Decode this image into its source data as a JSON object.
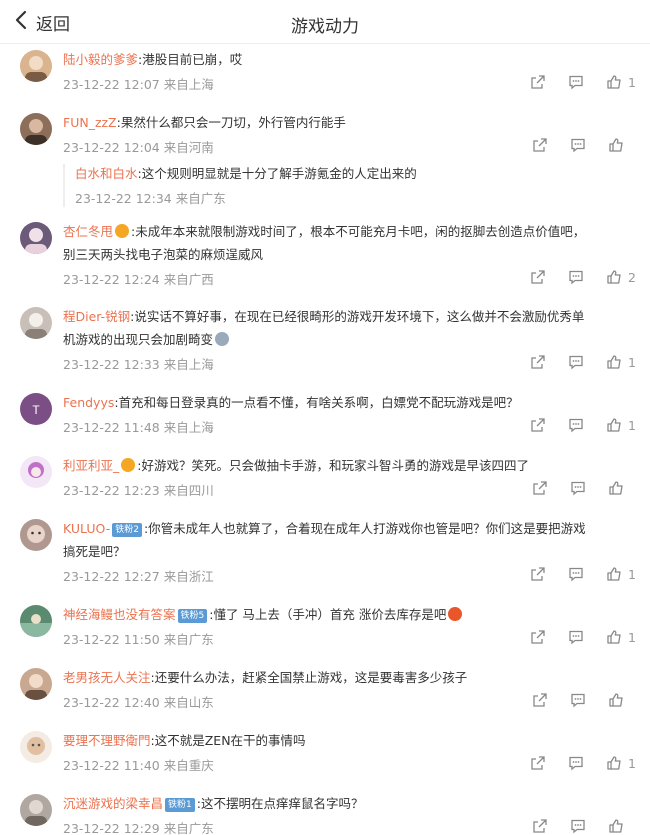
{
  "header": {
    "back_label": "返回",
    "title": "游戏动力"
  },
  "comments": [
    {
      "user": "陆小毅的爹爹",
      "badge": "",
      "text": ":港股目前已崩，哎",
      "text2": "",
      "time": "23-12-22 12:07 来自上海",
      "likes": "1",
      "avatar_color": "#d9b48f"
    },
    {
      "user": "FUN_zzZ",
      "badge": "",
      "text": ":果然什么都只会一刀切，外行管内行能手",
      "text2": "",
      "time": "23-12-22 12:04 来自河南",
      "likes": "",
      "avatar_color": "#8c6e5a",
      "reply": {
        "user": "白水和白水",
        "text": ":这个规则明显就是十分了解手游氪金的人定出来的",
        "time": "23-12-22 12:34 来自广东"
      }
    },
    {
      "user": "杏仁冬甩",
      "badge": "",
      "text": ":未成年本来就限制游戏时间了，根本不可能充月卡吧，闲的抠脚去创造点价值吧，",
      "text2": "别三天两头找电子泡菜的麻烦逞威风",
      "time": "23-12-22 12:24 来自广西",
      "likes": "2",
      "avatar_color": "#6b5a7a"
    },
    {
      "user": "程Dier-锐钢",
      "badge": "",
      "text": ":说实话不算好事，在现在已经很畸形的游戏开发环境下，这么做并不会激励优秀单",
      "text2": "机游戏的出现只会加剧畸变",
      "time": "23-12-22 12:33 来自上海",
      "likes": "1",
      "avatar_color": "#c8c0b8"
    },
    {
      "user": "Fendyys",
      "badge": "",
      "text": ":首充和每日登录真的一点看不懂，有啥关系啊，白嫖党不配玩游戏是吧？",
      "text2": "",
      "time": "23-12-22 11:48 来自上海",
      "likes": "1",
      "avatar_color": "#7b4f86"
    },
    {
      "user": "利亚利亚_",
      "badge": "",
      "text": ":好游戏？笑死。只会做抽卡手游，和玩家斗智斗勇的游戏是早该四四了",
      "text2": "",
      "time": "23-12-22 12:23 来自四川",
      "likes": "",
      "avatar_color": "#c070c8"
    },
    {
      "user": "KULUO-",
      "badge": "铁粉2",
      "text": ":你管未成年人也就算了，合着现在成年人打游戏你也管是吧？你们这是要把游戏",
      "text2": "搞死是吧？",
      "time": "23-12-22 12:27 来自浙江",
      "likes": "1",
      "avatar_color": "#b09890"
    },
    {
      "user": "神经海鳗也没有答案",
      "badge": "铁粉5",
      "text": ":懂了 马上去（手冲）首充  涨价去库存是吧",
      "text2": "",
      "time": "23-12-22 11:50 来自广东",
      "likes": "1",
      "avatar_color": "#5a8a70"
    },
    {
      "user": "老男孩无人关注",
      "badge": "",
      "text": ":还要什么办法，赶紧全国禁止游戏，这是要毒害多少孩子",
      "text2": "",
      "time": "23-12-22 12:40 来自山东",
      "likes": "",
      "avatar_color": "#c8a890"
    },
    {
      "user": "要理不理野衛門",
      "badge": "",
      "text": ":这不就是ZEN在干的事情吗",
      "text2": "",
      "time": "23-12-22 11:40 来自重庆",
      "likes": "1",
      "avatar_color": "#e0c0a0"
    },
    {
      "user": "沉迷游戏的梁幸昌",
      "badge": "铁粉1",
      "text": ":这不摆明在点痒痒鼠名字吗？",
      "text2": "",
      "time": "23-12-22 12:29 来自广东",
      "likes": "",
      "avatar_color": "#b0a8a0"
    }
  ]
}
